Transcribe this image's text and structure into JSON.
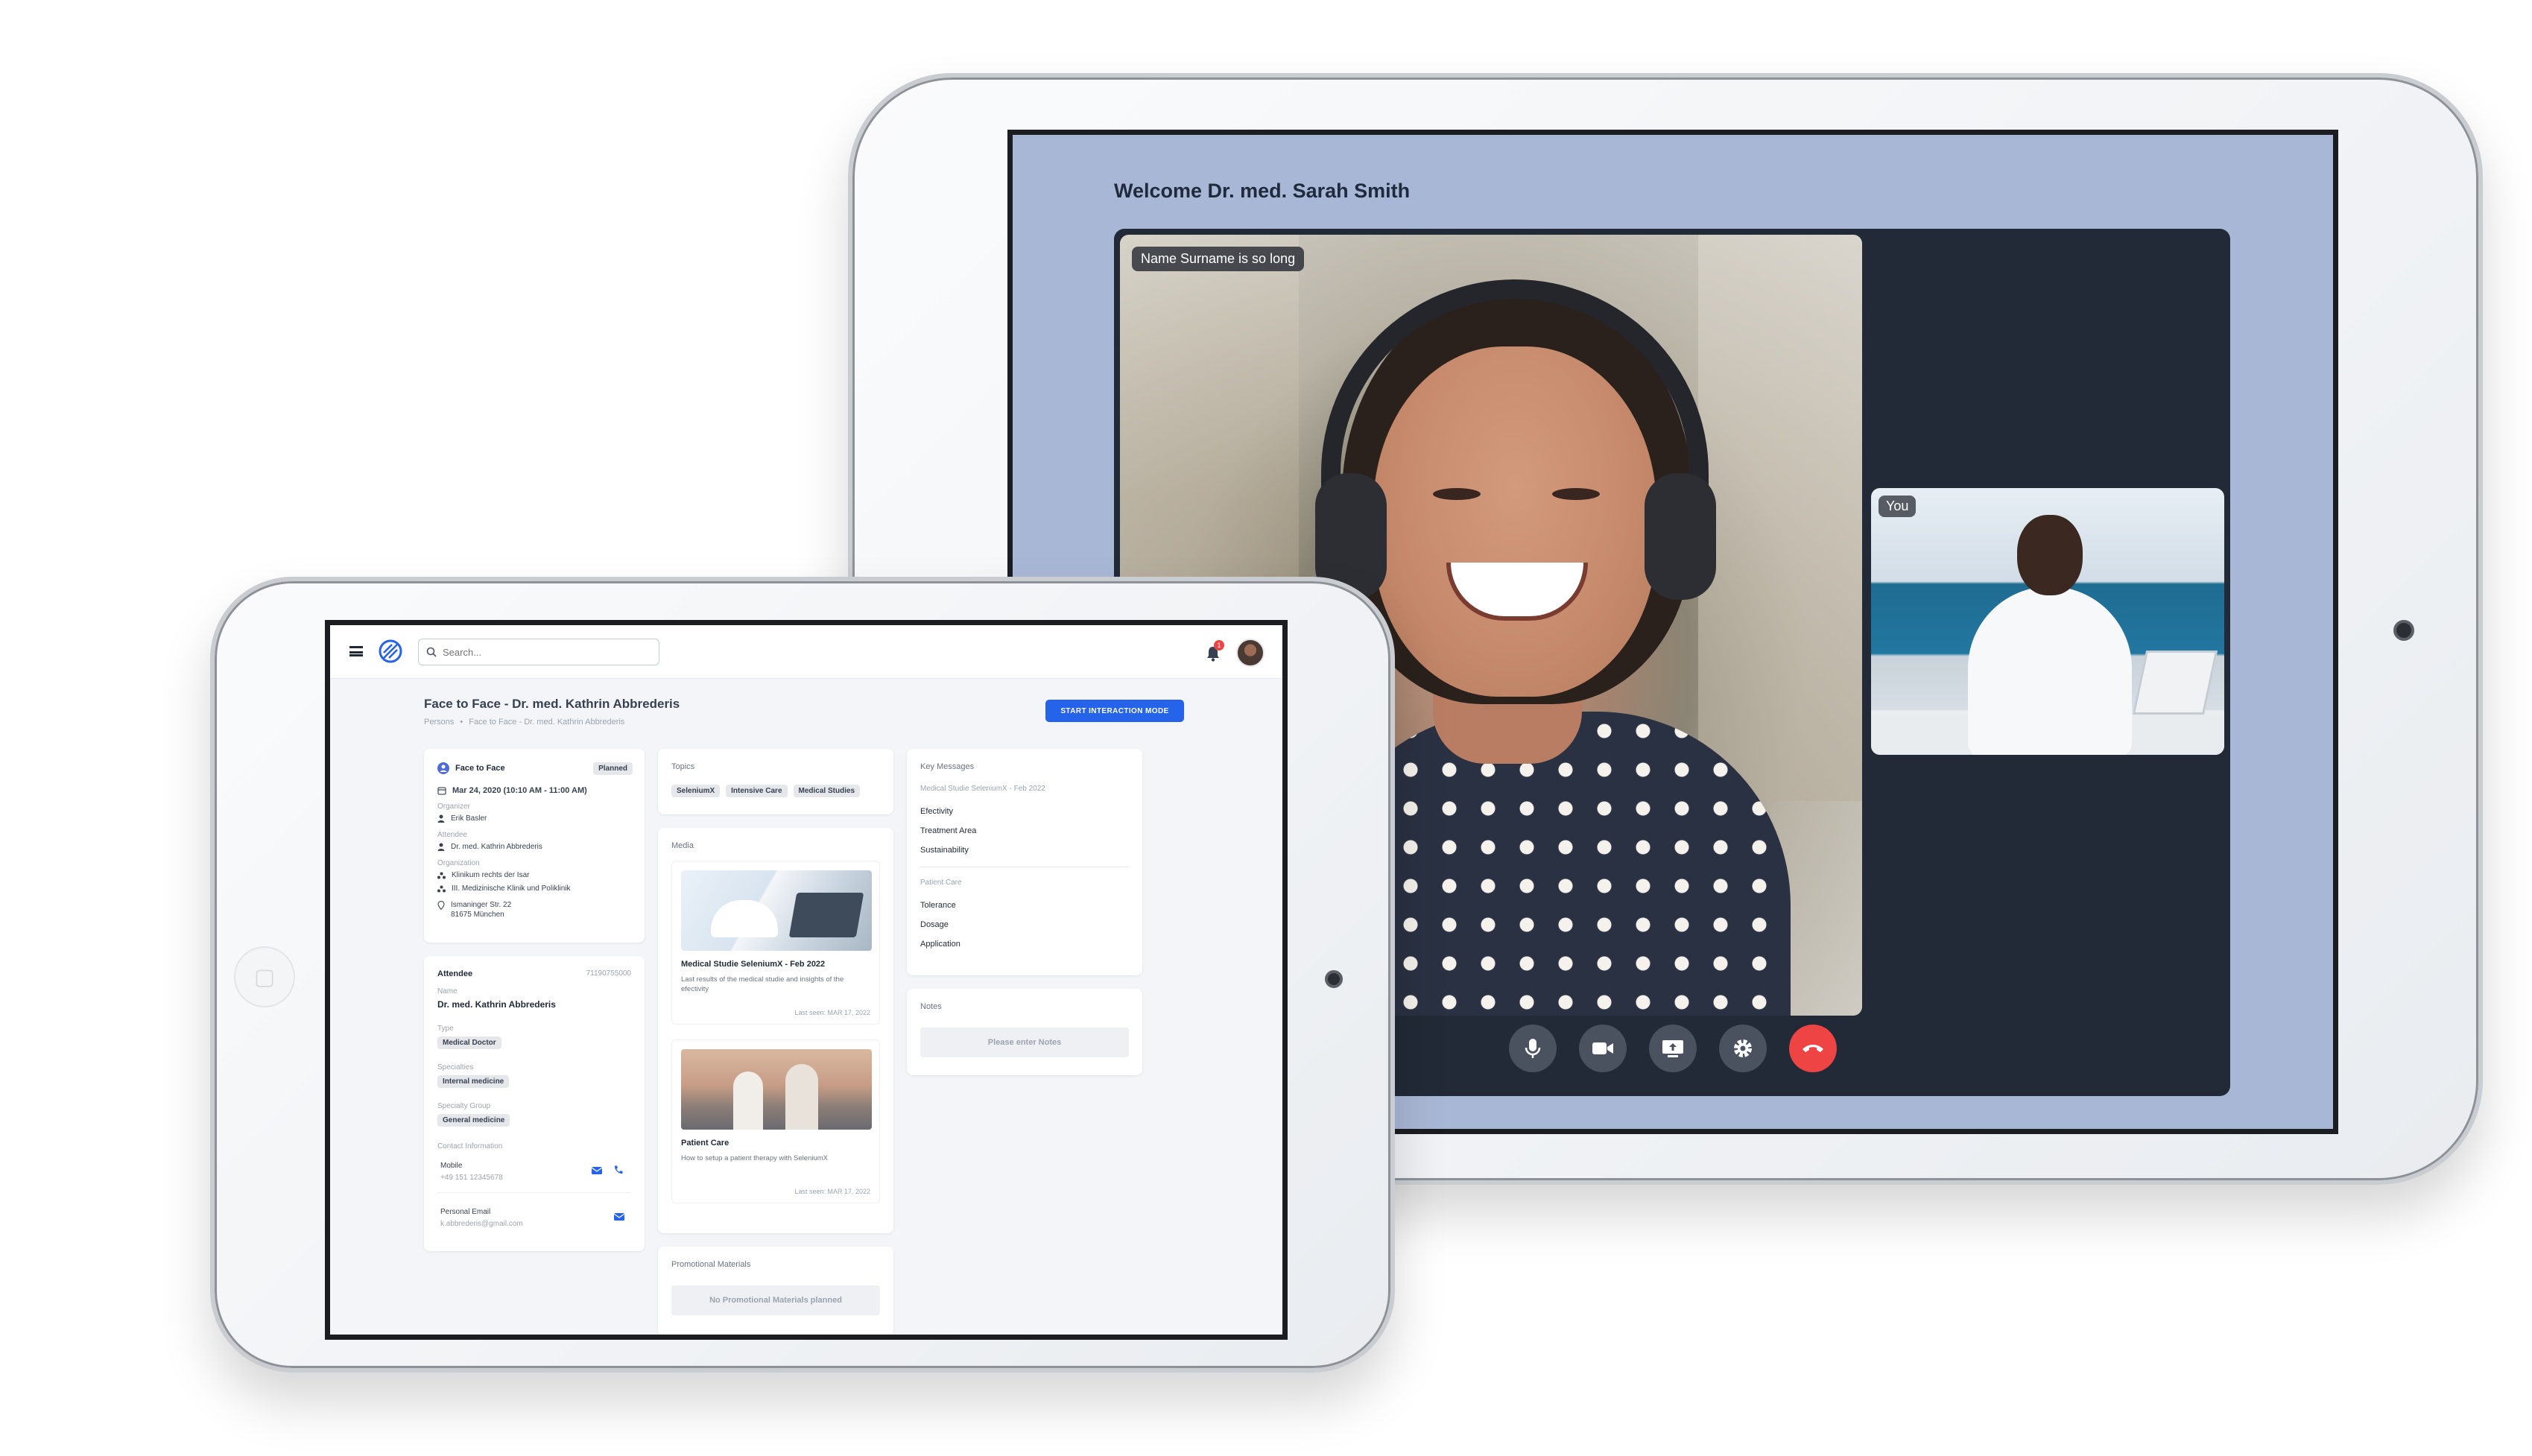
{
  "video_call": {
    "welcome": "Welcome Dr. med. Sarah Smith",
    "participant_name": "Name Surname is so long",
    "self_label": "You",
    "controls": [
      "microphone",
      "camera",
      "share-screen",
      "settings",
      "hang-up"
    ]
  },
  "crm": {
    "search_placeholder": "Search...",
    "notification_count": "1",
    "page_title": "Face to Face - Dr. med. Kathrin Abbrederis",
    "breadcrumb": [
      "Persons",
      "•",
      "Face to Face - Dr. med. Kathrin Abbrederis"
    ],
    "start_button": "START INTERACTION MODE",
    "interaction": {
      "type": "Face to Face",
      "status": "Planned",
      "datetime": "Mar 24, 2020 (10:10 AM - 11:00 AM)",
      "organizer_label": "Organizer",
      "organizer": "Erik Basler",
      "attendee_label": "Attendee",
      "attendee": "Dr. med. Kathrin Abbrederis",
      "organization_label": "Organization",
      "organization_1": "Klinikum rechts der Isar",
      "organization_2": "III. Medizinische Klinik und Poliklinik",
      "address_1": "Ismaninger Str. 22",
      "address_2": "81675 München"
    },
    "attendee_card": {
      "title": "Attendee",
      "id": "71190755000",
      "name_label": "Name",
      "name": "Dr. med. Kathrin Abbrederis",
      "type_label": "Type",
      "type": "Medical Doctor",
      "specialties_label": "Specialties",
      "specialty": "Internal medicine",
      "specialty_group_label": "Specialty Group",
      "specialty_group": "General medicine",
      "contact_label": "Contact Information",
      "mobile_label": "Mobile",
      "mobile": "+49 151 12345678",
      "email_label": "Personal Email",
      "email": "k.abbrederis@gmail.com"
    },
    "topics": {
      "title": "Topics",
      "items": [
        "SeleniumX",
        "Intensive Care",
        "Medical Studies"
      ]
    },
    "media": {
      "title": "Media",
      "items": [
        {
          "title": "Medical Studie SeleniumX - Feb 2022",
          "desc": "Last results of the medical studie and insights of the efectivity",
          "seen": "Last seen: MAR 17, 2022"
        },
        {
          "title": "Patient Care",
          "desc": "How to setup a patient therapy with SeleniumX",
          "seen": "Last seen: MAR 17, 2022"
        }
      ]
    },
    "promotional": {
      "title": "Promotional Materials",
      "empty": "No Promotional Materials planned"
    },
    "key_messages": {
      "title": "Key Messages",
      "group_1": "Medical Studie SeleniumX - Feb 2022",
      "group_1_items": [
        "Efectivity",
        "Treatment Area",
        "Sustainability"
      ],
      "group_2": "Patient Care",
      "group_2_items": [
        "Tolerance",
        "Dosage",
        "Application"
      ]
    },
    "notes": {
      "title": "Notes",
      "placeholder": "Please enter Notes"
    }
  }
}
